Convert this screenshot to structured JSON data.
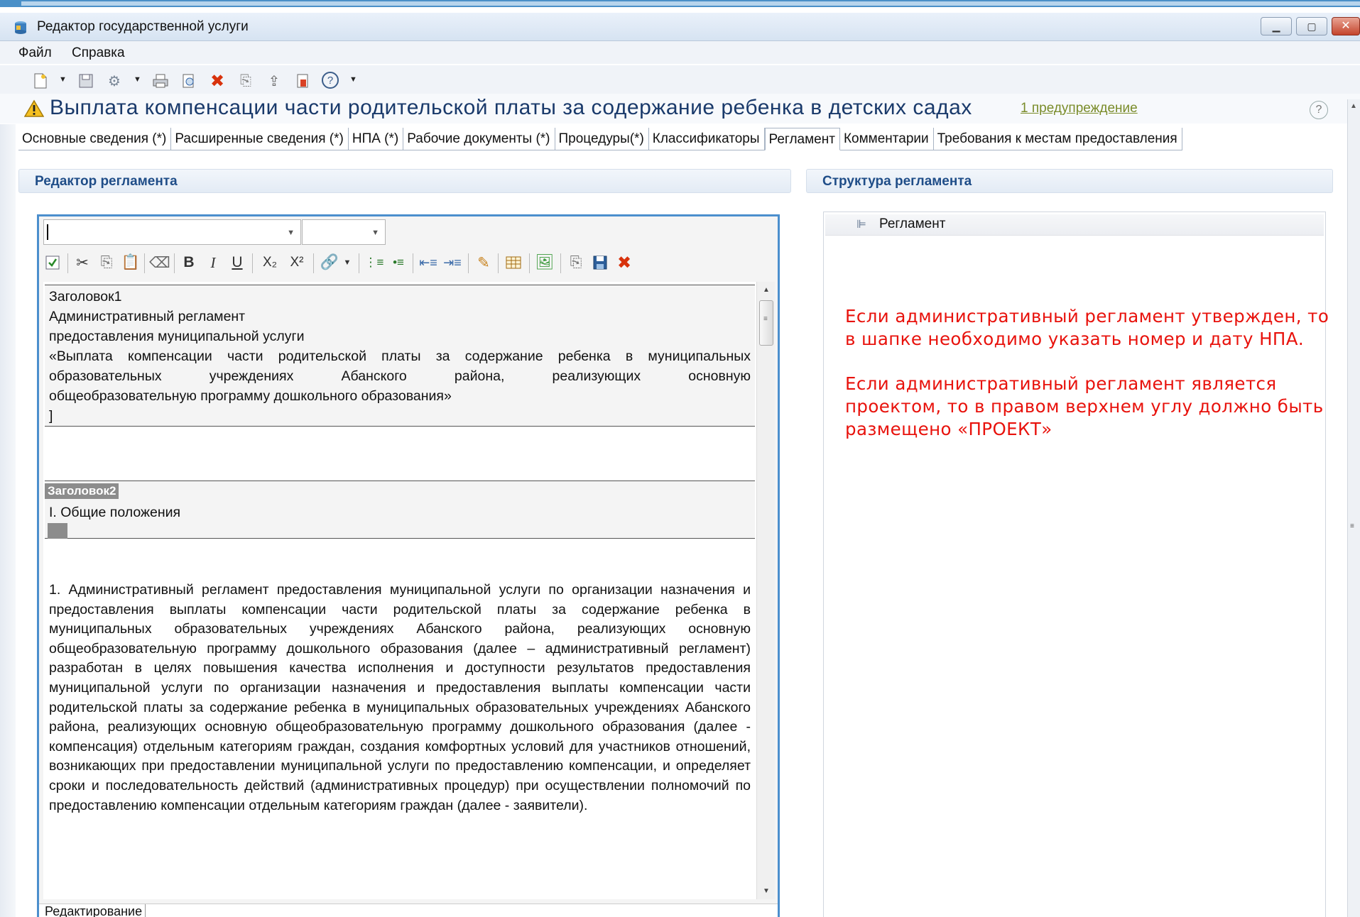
{
  "window": {
    "title": "Редактор государственной услуги"
  },
  "menu": [
    "Файл",
    "Справка"
  ],
  "header": {
    "title": "Выплата компенсации части родительской платы за содержание ребенка в детских садах",
    "warning_link": "1 предупреждение",
    "help_glyph": "?"
  },
  "tabs": [
    "Основные сведения (*)",
    "Расширенные сведения (*)",
    "НПА (*)",
    "Рабочие документы (*)",
    "Процедуры(*)",
    "Классификаторы",
    "Регламент",
    "Комментарии",
    "Требования к местам предоставления"
  ],
  "active_tab": "Регламент",
  "left_panel": {
    "title": "Редактор регламента"
  },
  "right_panel": {
    "title": "Структура регламента",
    "tree_root": "Регламент"
  },
  "editor": {
    "format_buttons": {
      "bold": "B",
      "italic": "I",
      "underline": "U",
      "subscript": "X₂",
      "superscript": "X²"
    },
    "block1": {
      "tag": "Заголовок1",
      "lines": [
        "Административный регламент",
        "предоставления муниципальной услуги",
        "«Выплата компенсации части родительской платы за содержание ребенка в муниципальных",
        "образовательных учреждениях Абанского района, реализующих основную",
        "общеобразовательную программу дошкольного образования»",
        "]"
      ]
    },
    "block2": {
      "tag": "Заголовок2",
      "line": "I. Общие положения"
    },
    "paragraph": "1. Административный регламент предоставления муниципальной  услуги по организации назначения и предоставления выплаты компенсации части родительской платы за содержание ребенка в муниципальных образовательных учреждениях Абанского района, реализующих основную общеобразовательную программу дошкольного образования (далее – административный регламент)  разработан в целях повышения качества исполнения и доступности результатов предоставления муниципальной услуги по организации назначения и предоставления выплаты компенсации части родительской платы за содержание ребенка в муниципальных образовательных учреждениях Абанского района, реализующих основную общеобразовательную программу дошкольного образования (далее - компенсация) отдельным категориям граждан, создания комфортных условий для участников отношений, возникающих при предоставлении муниципальной услуги по предоставлению компенсации, и определяет сроки и последовательность действий (административных процедур) при осуществлении полномочий по  предоставлению компенсации отдельным категориям граждан (далее - заявители).",
    "status_tab": "Редактирование"
  },
  "annotations": [
    [
      "Если административный регламент утвержден, то",
      "в шапке необходимо указать номер и дату НПА."
    ],
    [
      "Если административный регламент является",
      "проектом, то в правом верхнем углу должно быть",
      "размещено «ПРОЕКТ»"
    ]
  ],
  "colors": {
    "accent": "#4c8fcd",
    "annotation": "#e8120c",
    "panel_title": "#1f4d88",
    "heading": "#1a3a6b"
  }
}
